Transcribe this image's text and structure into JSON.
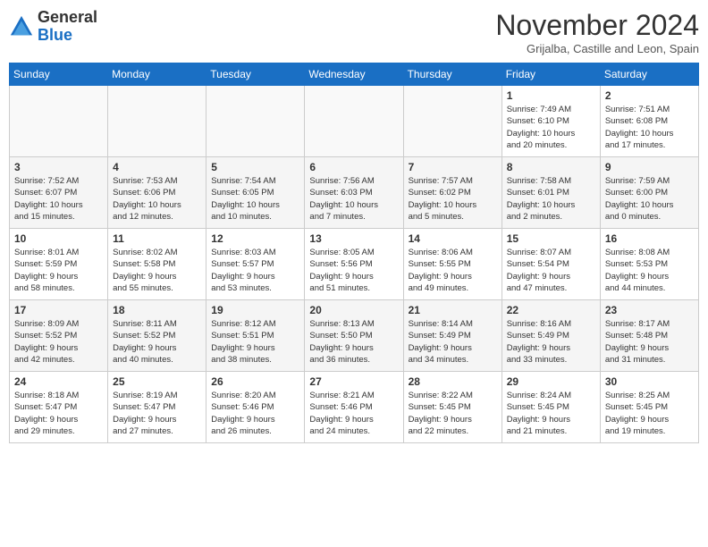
{
  "header": {
    "logo_general": "General",
    "logo_blue": "Blue",
    "month": "November 2024",
    "location": "Grijalba, Castille and Leon, Spain"
  },
  "days_of_week": [
    "Sunday",
    "Monday",
    "Tuesday",
    "Wednesday",
    "Thursday",
    "Friday",
    "Saturday"
  ],
  "weeks": [
    [
      {
        "day": "",
        "info": ""
      },
      {
        "day": "",
        "info": ""
      },
      {
        "day": "",
        "info": ""
      },
      {
        "day": "",
        "info": ""
      },
      {
        "day": "",
        "info": ""
      },
      {
        "day": "1",
        "info": "Sunrise: 7:49 AM\nSunset: 6:10 PM\nDaylight: 10 hours\nand 20 minutes."
      },
      {
        "day": "2",
        "info": "Sunrise: 7:51 AM\nSunset: 6:08 PM\nDaylight: 10 hours\nand 17 minutes."
      }
    ],
    [
      {
        "day": "3",
        "info": "Sunrise: 7:52 AM\nSunset: 6:07 PM\nDaylight: 10 hours\nand 15 minutes."
      },
      {
        "day": "4",
        "info": "Sunrise: 7:53 AM\nSunset: 6:06 PM\nDaylight: 10 hours\nand 12 minutes."
      },
      {
        "day": "5",
        "info": "Sunrise: 7:54 AM\nSunset: 6:05 PM\nDaylight: 10 hours\nand 10 minutes."
      },
      {
        "day": "6",
        "info": "Sunrise: 7:56 AM\nSunset: 6:03 PM\nDaylight: 10 hours\nand 7 minutes."
      },
      {
        "day": "7",
        "info": "Sunrise: 7:57 AM\nSunset: 6:02 PM\nDaylight: 10 hours\nand 5 minutes."
      },
      {
        "day": "8",
        "info": "Sunrise: 7:58 AM\nSunset: 6:01 PM\nDaylight: 10 hours\nand 2 minutes."
      },
      {
        "day": "9",
        "info": "Sunrise: 7:59 AM\nSunset: 6:00 PM\nDaylight: 10 hours\nand 0 minutes."
      }
    ],
    [
      {
        "day": "10",
        "info": "Sunrise: 8:01 AM\nSunset: 5:59 PM\nDaylight: 9 hours\nand 58 minutes."
      },
      {
        "day": "11",
        "info": "Sunrise: 8:02 AM\nSunset: 5:58 PM\nDaylight: 9 hours\nand 55 minutes."
      },
      {
        "day": "12",
        "info": "Sunrise: 8:03 AM\nSunset: 5:57 PM\nDaylight: 9 hours\nand 53 minutes."
      },
      {
        "day": "13",
        "info": "Sunrise: 8:05 AM\nSunset: 5:56 PM\nDaylight: 9 hours\nand 51 minutes."
      },
      {
        "day": "14",
        "info": "Sunrise: 8:06 AM\nSunset: 5:55 PM\nDaylight: 9 hours\nand 49 minutes."
      },
      {
        "day": "15",
        "info": "Sunrise: 8:07 AM\nSunset: 5:54 PM\nDaylight: 9 hours\nand 47 minutes."
      },
      {
        "day": "16",
        "info": "Sunrise: 8:08 AM\nSunset: 5:53 PM\nDaylight: 9 hours\nand 44 minutes."
      }
    ],
    [
      {
        "day": "17",
        "info": "Sunrise: 8:09 AM\nSunset: 5:52 PM\nDaylight: 9 hours\nand 42 minutes."
      },
      {
        "day": "18",
        "info": "Sunrise: 8:11 AM\nSunset: 5:52 PM\nDaylight: 9 hours\nand 40 minutes."
      },
      {
        "day": "19",
        "info": "Sunrise: 8:12 AM\nSunset: 5:51 PM\nDaylight: 9 hours\nand 38 minutes."
      },
      {
        "day": "20",
        "info": "Sunrise: 8:13 AM\nSunset: 5:50 PM\nDaylight: 9 hours\nand 36 minutes."
      },
      {
        "day": "21",
        "info": "Sunrise: 8:14 AM\nSunset: 5:49 PM\nDaylight: 9 hours\nand 34 minutes."
      },
      {
        "day": "22",
        "info": "Sunrise: 8:16 AM\nSunset: 5:49 PM\nDaylight: 9 hours\nand 33 minutes."
      },
      {
        "day": "23",
        "info": "Sunrise: 8:17 AM\nSunset: 5:48 PM\nDaylight: 9 hours\nand 31 minutes."
      }
    ],
    [
      {
        "day": "24",
        "info": "Sunrise: 8:18 AM\nSunset: 5:47 PM\nDaylight: 9 hours\nand 29 minutes."
      },
      {
        "day": "25",
        "info": "Sunrise: 8:19 AM\nSunset: 5:47 PM\nDaylight: 9 hours\nand 27 minutes."
      },
      {
        "day": "26",
        "info": "Sunrise: 8:20 AM\nSunset: 5:46 PM\nDaylight: 9 hours\nand 26 minutes."
      },
      {
        "day": "27",
        "info": "Sunrise: 8:21 AM\nSunset: 5:46 PM\nDaylight: 9 hours\nand 24 minutes."
      },
      {
        "day": "28",
        "info": "Sunrise: 8:22 AM\nSunset: 5:45 PM\nDaylight: 9 hours\nand 22 minutes."
      },
      {
        "day": "29",
        "info": "Sunrise: 8:24 AM\nSunset: 5:45 PM\nDaylight: 9 hours\nand 21 minutes."
      },
      {
        "day": "30",
        "info": "Sunrise: 8:25 AM\nSunset: 5:45 PM\nDaylight: 9 hours\nand 19 minutes."
      }
    ]
  ]
}
